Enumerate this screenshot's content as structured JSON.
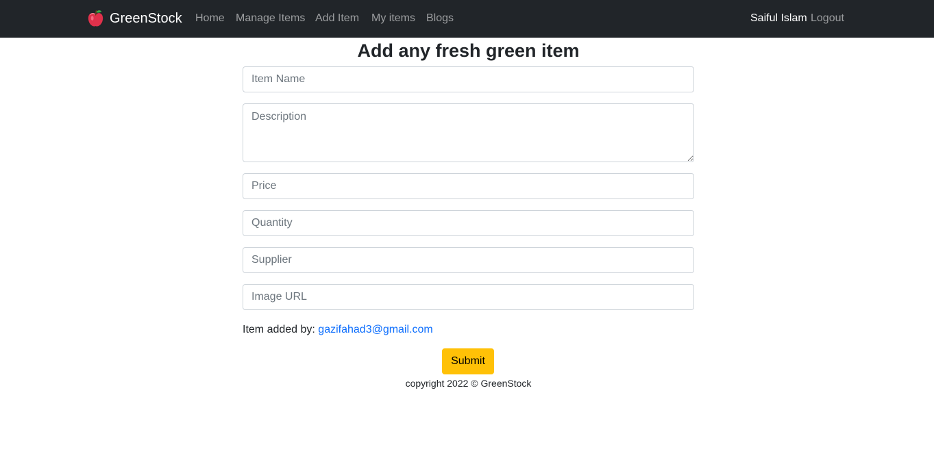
{
  "navbar": {
    "brand": "GreenStock",
    "links": [
      "Home",
      "Manage Items",
      "Add Item",
      "My items",
      "Blogs"
    ],
    "user_name": "Saiful Islam",
    "logout_label": "Logout"
  },
  "page": {
    "title": "Add any fresh green item"
  },
  "form": {
    "item_name_placeholder": "Item Name",
    "description_placeholder": "Description",
    "price_placeholder": "Price",
    "quantity_placeholder": "Quantity",
    "supplier_placeholder": "Supplier",
    "image_url_placeholder": "Image URL",
    "added_by_label": "Item added by:",
    "added_by_email": "gazifahad3@gmail.com",
    "submit_label": "Submit"
  },
  "footer": {
    "text": "copyright 2022 © GreenStock"
  },
  "colors": {
    "navbar_bg": "#212529",
    "submit_bg": "#ffc107",
    "link": "#0d6efd"
  },
  "icons": {
    "brand_logo": "apple-icon"
  }
}
